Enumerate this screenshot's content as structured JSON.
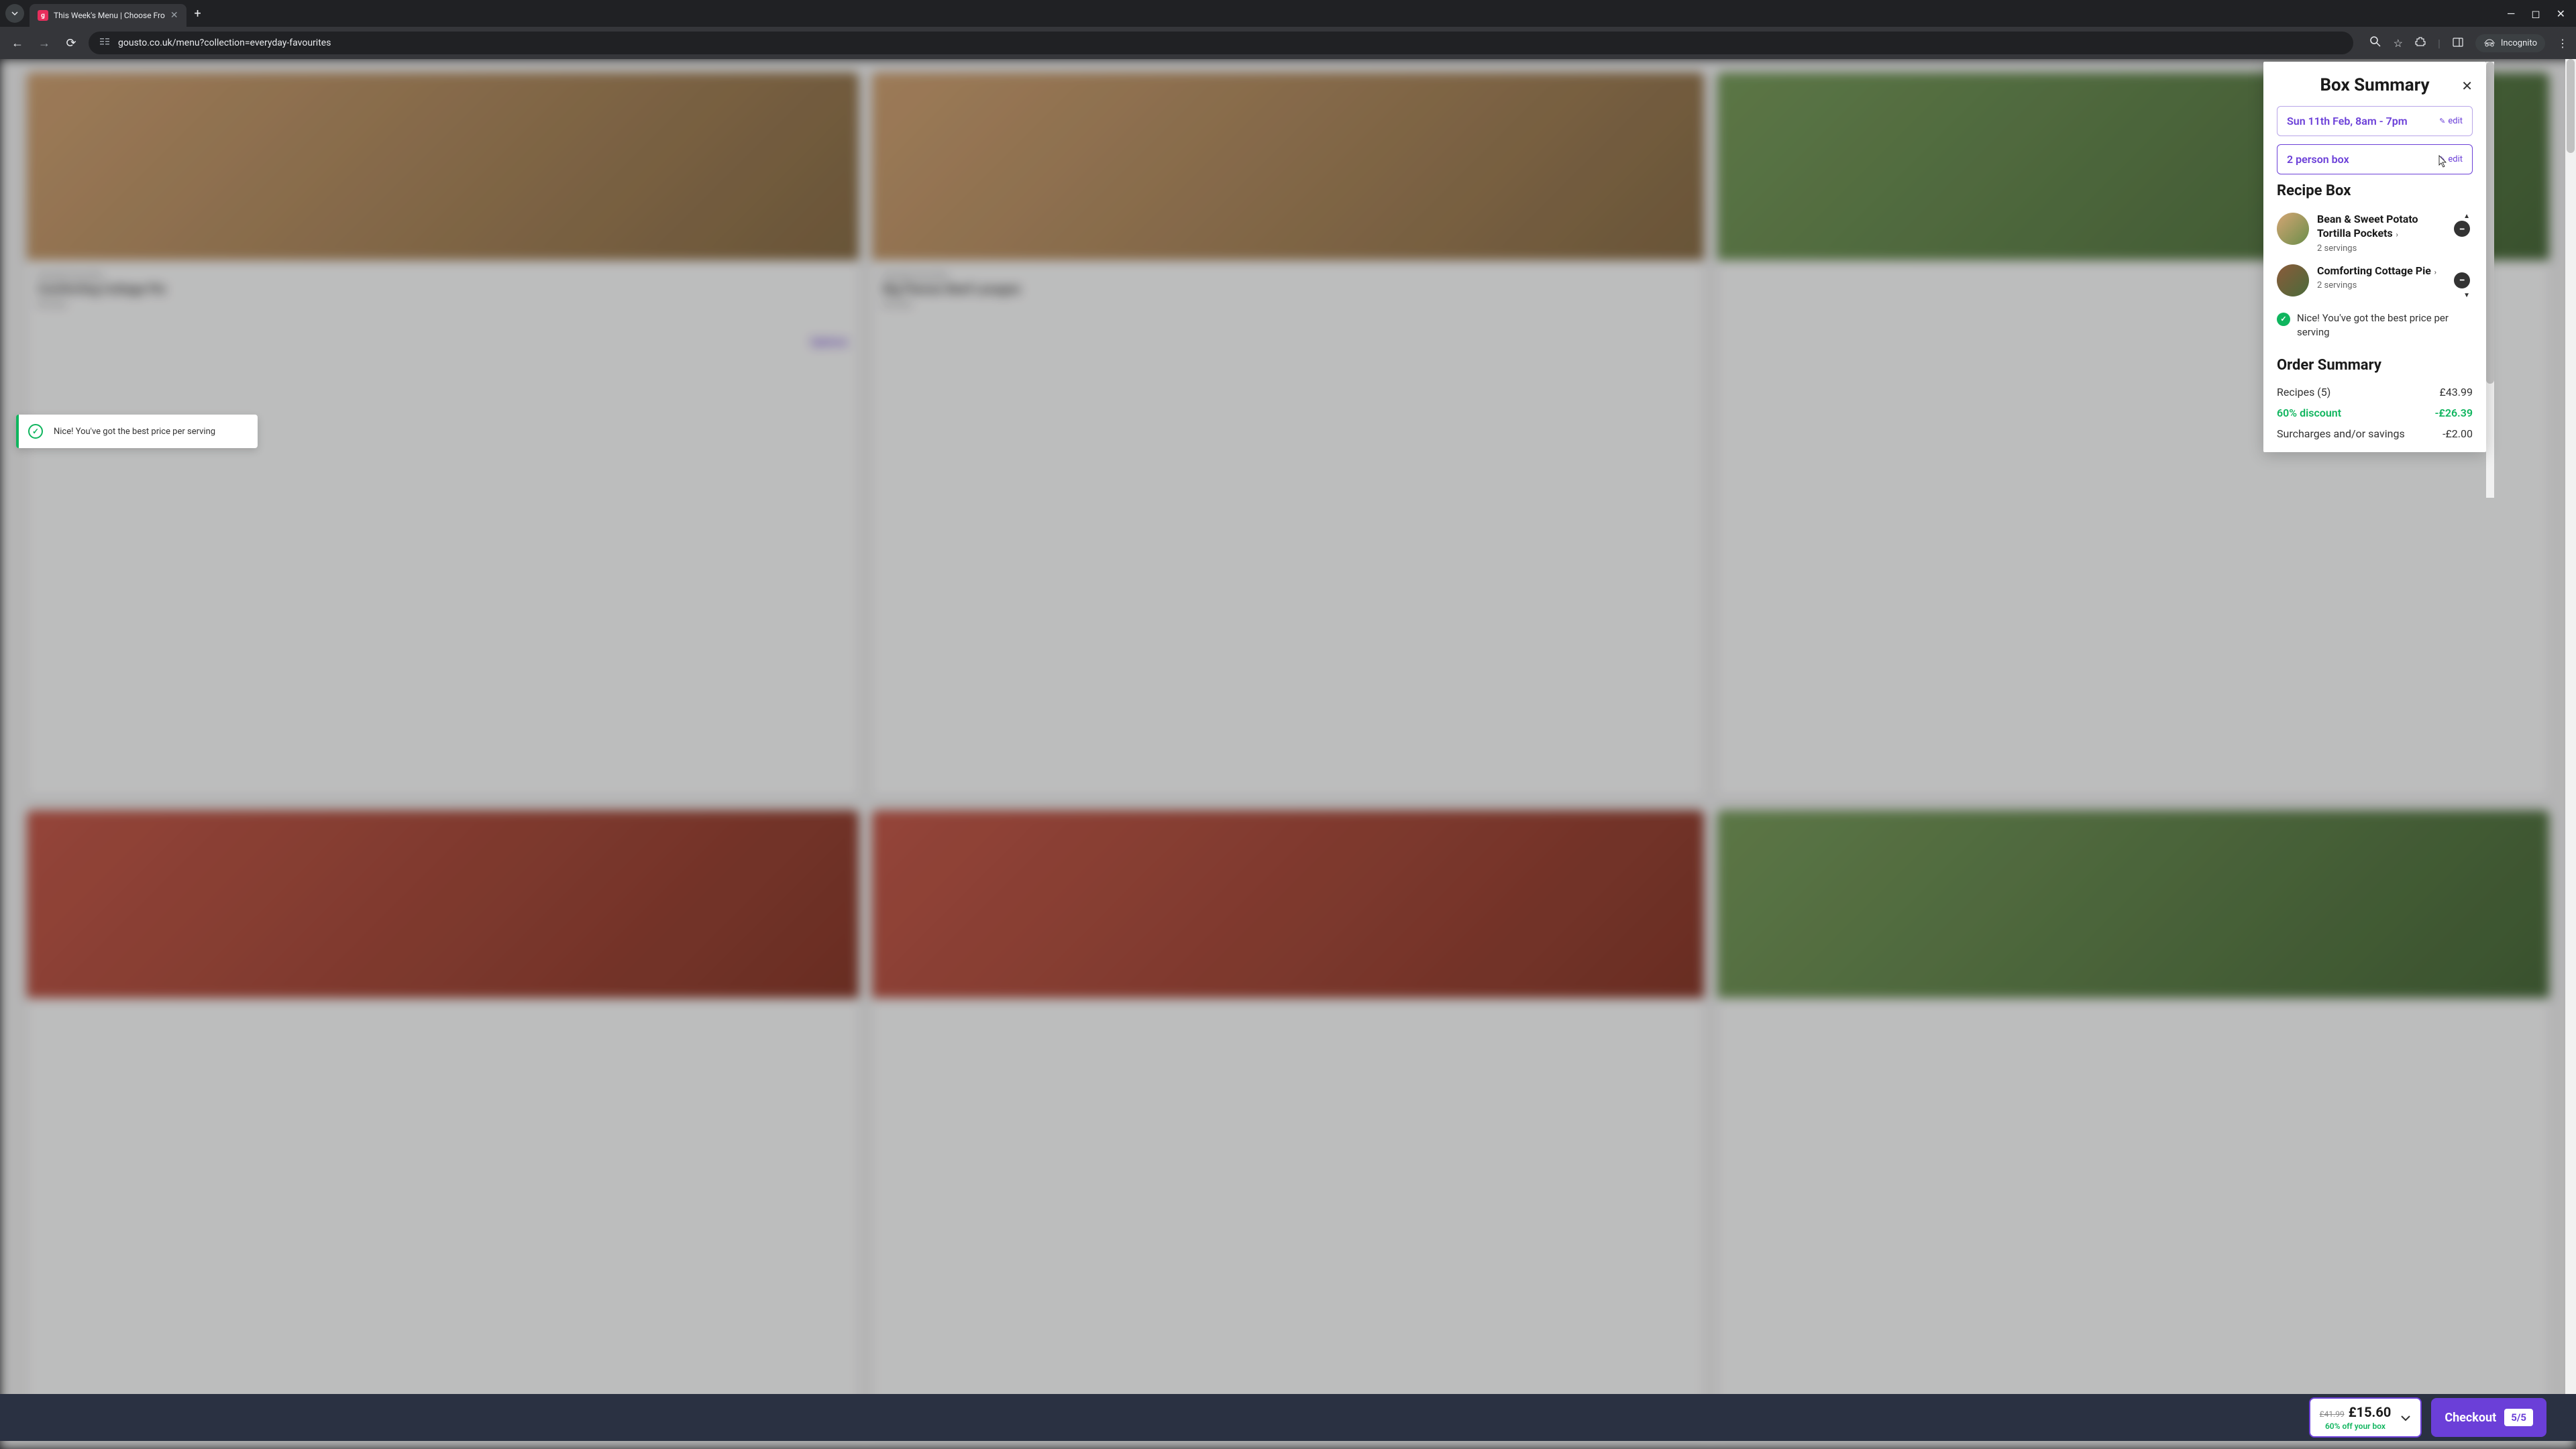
{
  "browser": {
    "tab": {
      "favicon": "g",
      "title": "This Week's Menu | Choose Fro"
    },
    "url": "gousto.co.uk/menu?collection=everyday-favourites",
    "incognito": "Incognito"
  },
  "bg": {
    "card1": {
      "tag": "Everyday Favourites",
      "title": "Comforting Cottage Pie",
      "time": "45 mins"
    },
    "card2": {
      "tag": "Everyday Favourites",
      "title": "Big Flavour Beef Lasagne",
      "time": "45 mins"
    },
    "options": "Options"
  },
  "toast": {
    "text": "Nice! You've got the best price per serving"
  },
  "panel": {
    "title": "Box Summary",
    "delivery": "Sun 11th Feb, 8am - 7pm",
    "edit": "edit",
    "boxSize": "2 person box",
    "recipeBoxTitle": "Recipe Box",
    "recipes": [
      {
        "name": "Bean & Sweet Potato Tortilla Pockets",
        "servings": "2 servings"
      },
      {
        "name": "Comforting Cottage Pie",
        "servings": "2 servings"
      }
    ],
    "bestPrice": "Nice! You've got the best price per serving",
    "orderTitle": "Order Summary",
    "order": {
      "recipesLabel": "Recipes (5)",
      "recipesValue": "£43.99",
      "discountLabel": "60% discount",
      "discountValue": "-£26.39",
      "surchargesLabel": "Surcharges and/or savings",
      "surchargesValue": "-£2.00"
    }
  },
  "bottomBar": {
    "oldPrice": "£41.99",
    "newPrice": "£15.60",
    "discount": "60% off your box",
    "checkout": "Checkout",
    "count": "5/5"
  }
}
